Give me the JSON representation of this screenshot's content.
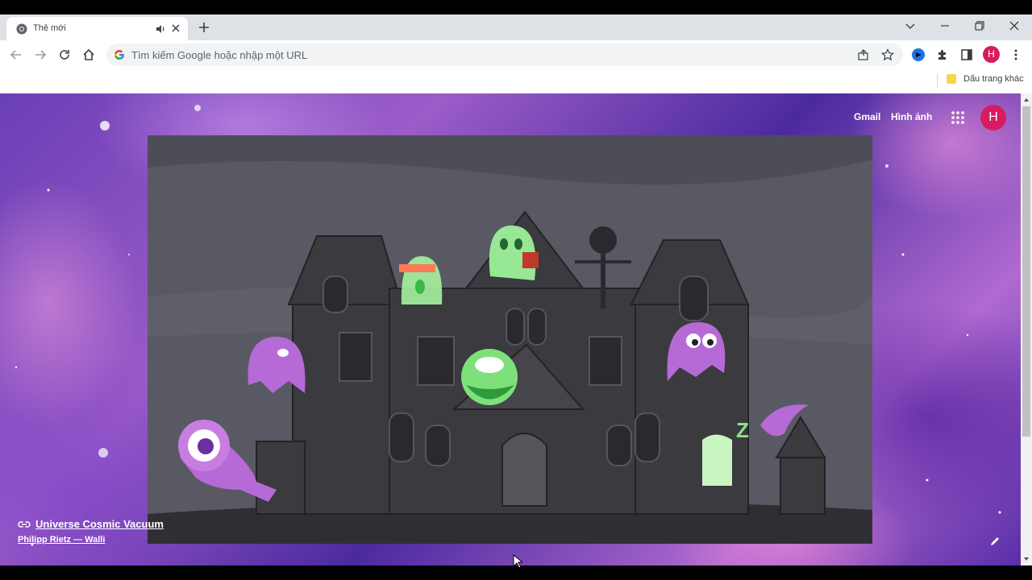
{
  "tab": {
    "title": "Thẻ mới"
  },
  "omnibox": {
    "placeholder": "Tìm kiếm Google hoặc nhập một URL"
  },
  "bookmarks": {
    "other_label": "Dấu trang khác"
  },
  "profile": {
    "initial": "H",
    "color": "#d81b60"
  },
  "ntp": {
    "links": {
      "gmail": "Gmail",
      "images": "Hình ảnh"
    },
    "background_credit": {
      "title": "Universe Cosmic Vacuum",
      "author": "Philipp Rietz — Walli"
    }
  },
  "doodle": {
    "theme": "halloween-haunted-house",
    "background_color": "#55555f"
  },
  "icons": [
    "chrome-icon",
    "audio-icon",
    "close-icon",
    "plus-icon",
    "back-icon",
    "forward-icon",
    "reload-icon",
    "home-icon",
    "google-icon",
    "share-icon",
    "star-icon",
    "extension-icon",
    "puzzle-icon",
    "side-panel-icon",
    "menu-icon",
    "apps-icon",
    "link-icon",
    "pencil-icon"
  ]
}
